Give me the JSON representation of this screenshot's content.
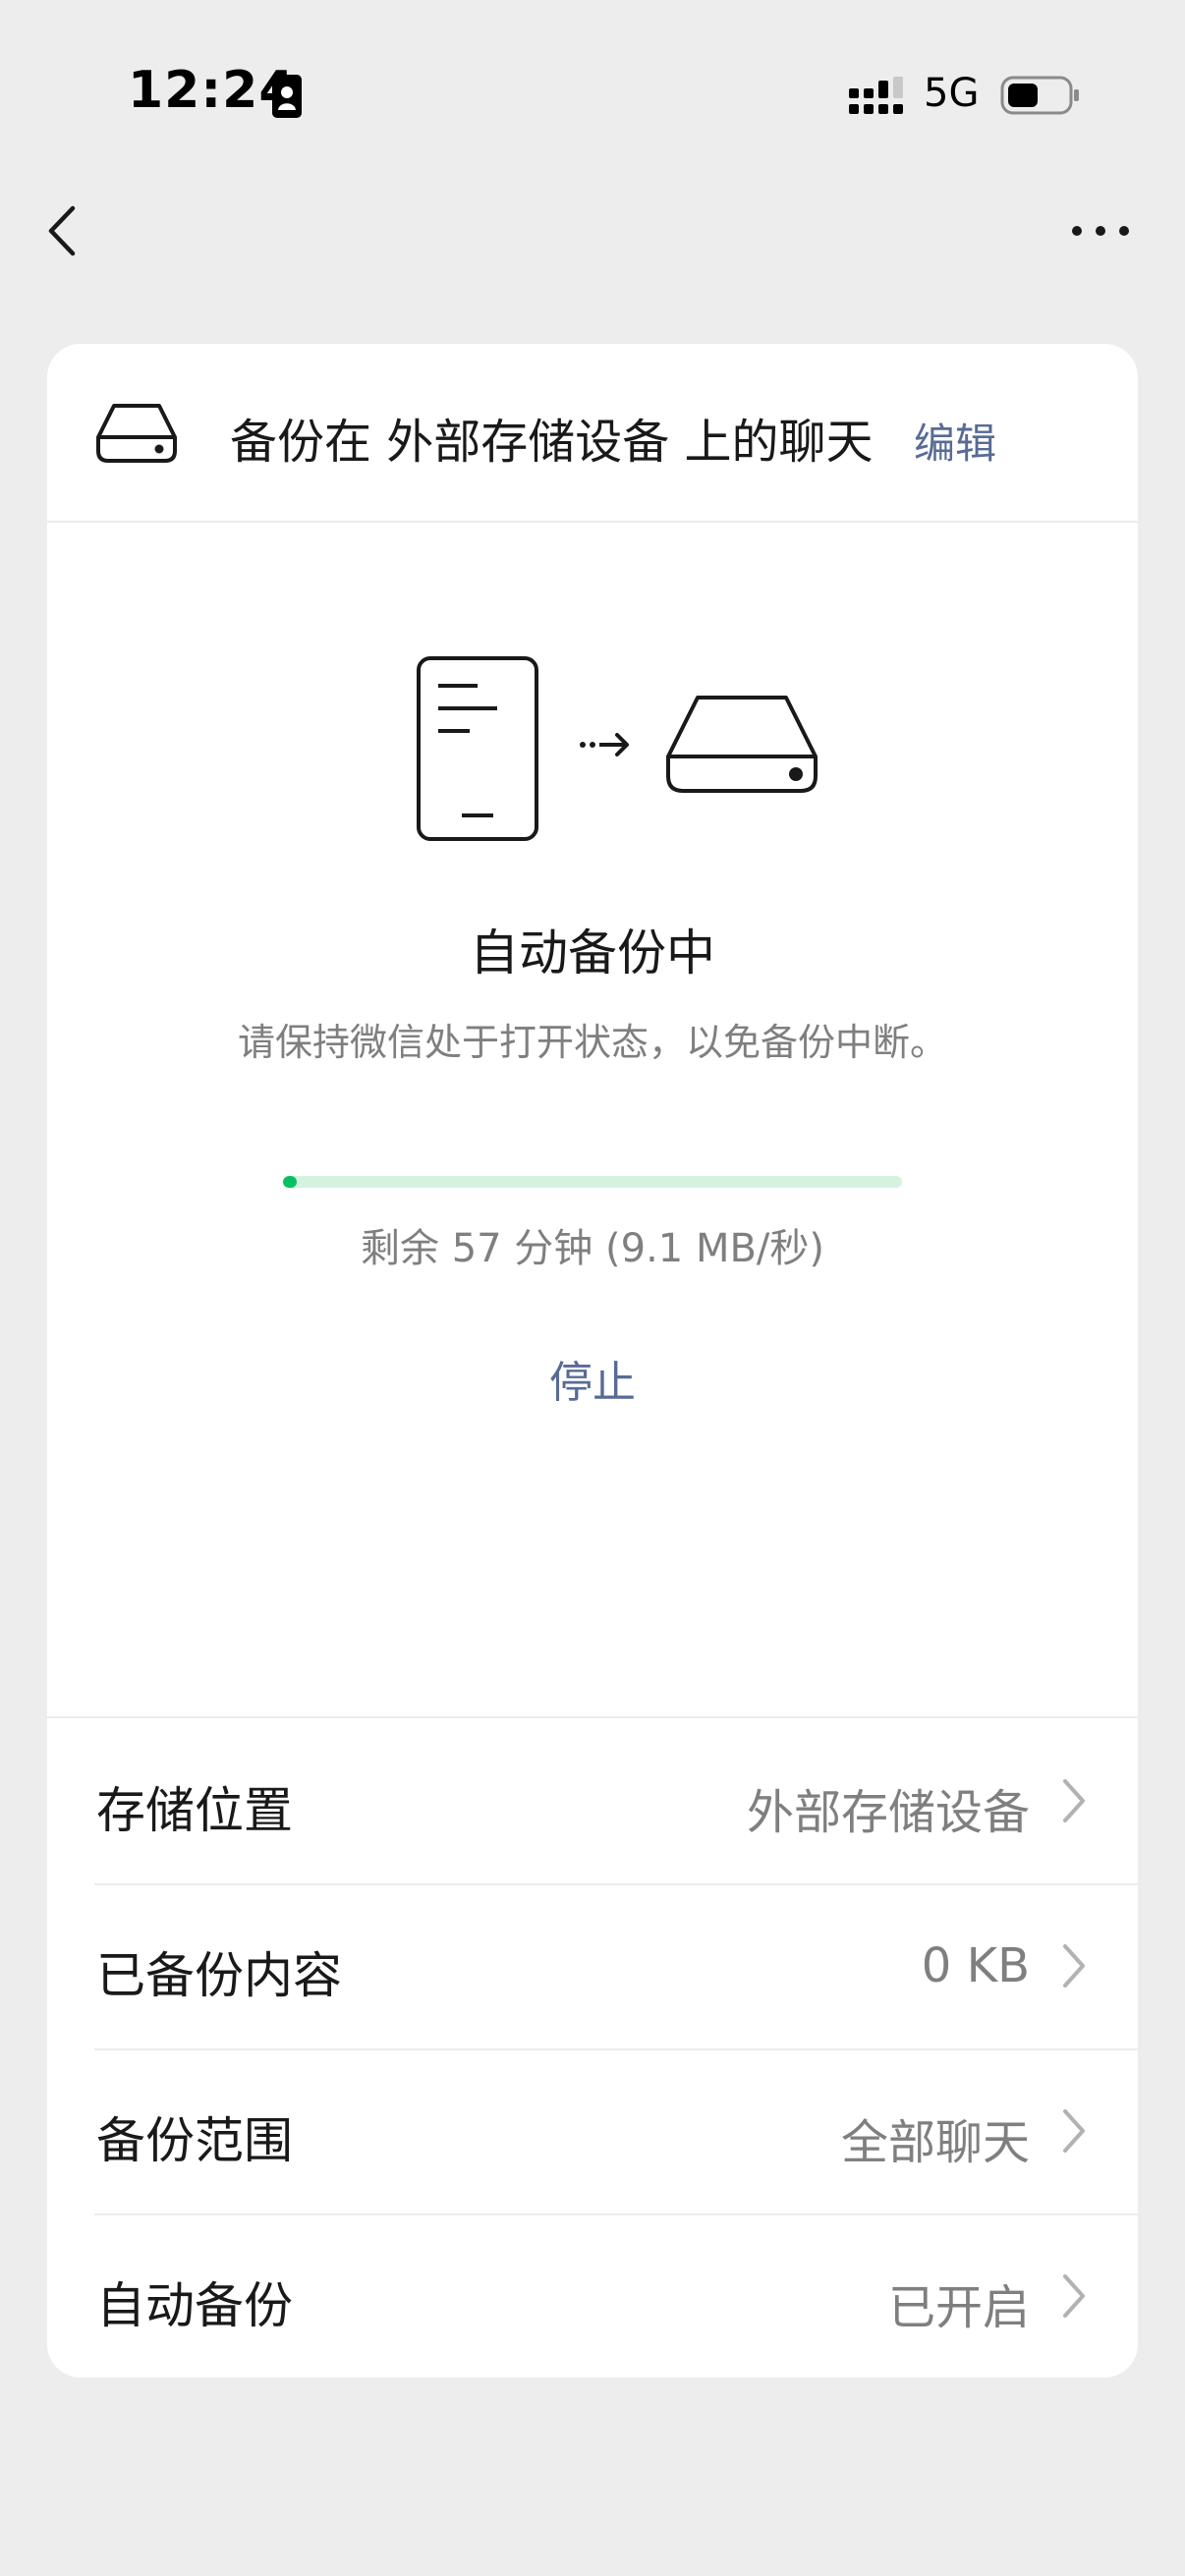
{
  "status_bar": {
    "time": "12:24",
    "network": "5G"
  },
  "header": {
    "title": "备份在 外部存储设备 上的聊天",
    "edit_label": "编辑"
  },
  "backup": {
    "status_title": "自动备份中",
    "hint": "请保持微信处于打开状态，以免备份中断。",
    "progress_fraction": 0.02,
    "remaining": "剩余 57 分钟 (9.1 MB/秒)",
    "stop_label": "停止"
  },
  "settings": [
    {
      "label": "存储位置",
      "value": "外部存储设备"
    },
    {
      "label": "已备份内容",
      "value": "0 KB"
    },
    {
      "label": "备份范围",
      "value": "全部聊天"
    },
    {
      "label": "自动备份",
      "value": "已开启"
    }
  ],
  "colors": {
    "accent_link": "#576b95",
    "progress_fill": "#07c160",
    "progress_track": "#d5f2e0",
    "background": "#ededed"
  }
}
